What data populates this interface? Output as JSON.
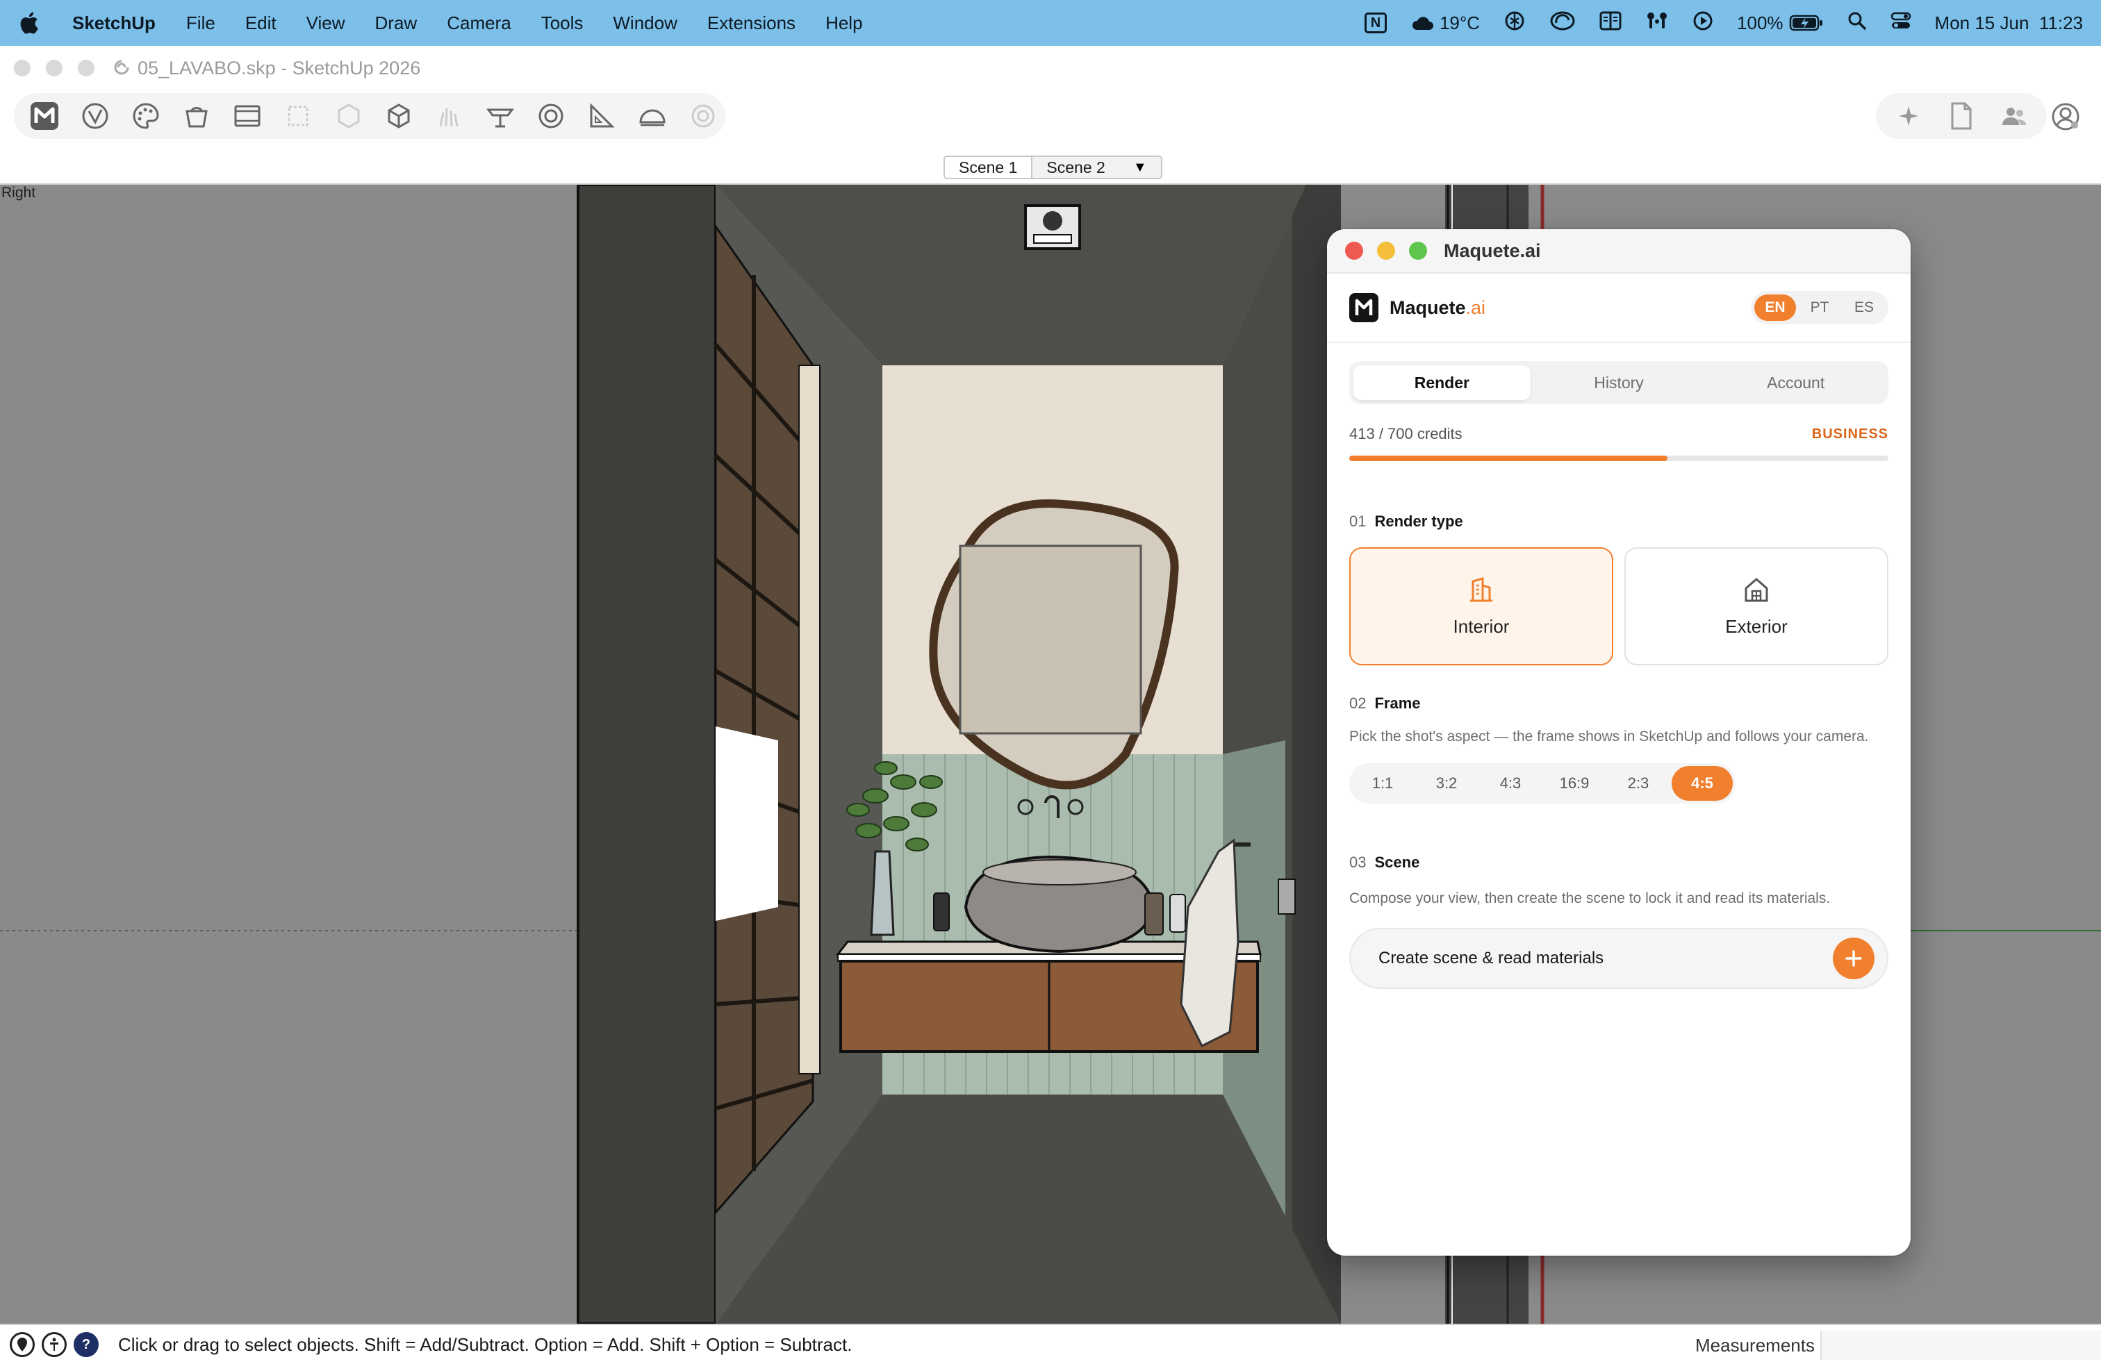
{
  "menubar": {
    "app_name": "SketchUp",
    "menus": [
      "File",
      "Edit",
      "View",
      "Draw",
      "Camera",
      "Tools",
      "Window",
      "Extensions",
      "Help"
    ],
    "status": {
      "notion_icon": "N",
      "weather": "19°C",
      "battery": "100%",
      "datetime": "Mon 15 Jun  11:23"
    }
  },
  "window": {
    "title": "05_LAVABO.skp - SketchUp 2026"
  },
  "toolbar": {
    "tools": [
      "maquete-logo",
      "vray",
      "palette",
      "enscape",
      "window-frame",
      "selection-box",
      "cube",
      "box",
      "grass",
      "table",
      "target",
      "triangle-ruler",
      "dome",
      "circle-tool"
    ],
    "right_tools": [
      "sparkle",
      "document",
      "users"
    ]
  },
  "scenes": {
    "tabs": [
      "Scene 1",
      "Scene 2"
    ],
    "active": "Scene 1",
    "dropdown": "▼"
  },
  "viewport": {
    "view_name": "Right"
  },
  "statusbar": {
    "message": "Click or drag to select objects. Shift = Add/Subtract. Option = Add. Shift + Option = Subtract.",
    "measurements_label": "Measurements",
    "help_icon": "?"
  },
  "plugin": {
    "window_title": "Maquete.ai",
    "brand": {
      "name": "Maquete",
      "suffix": ".ai"
    },
    "languages": [
      "EN",
      "PT",
      "ES"
    ],
    "active_language": "EN",
    "tabs": [
      "Render",
      "History",
      "Account"
    ],
    "active_tab": "Render",
    "credits": {
      "text": "413 / 700 credits",
      "used": 413,
      "total": 700,
      "plan": "BUSINESS"
    },
    "render_type": {
      "number": "01",
      "title": "Render type",
      "options": [
        "Interior",
        "Exterior"
      ],
      "selected": "Interior"
    },
    "frame": {
      "number": "02",
      "title": "Frame",
      "description": "Pick the shot's aspect — the frame shows in SketchUp and follows your camera.",
      "ratios": [
        "1:1",
        "3:2",
        "4:3",
        "16:9",
        "2:3",
        "4:5"
      ],
      "selected": "4:5"
    },
    "scene": {
      "number": "03",
      "title": "Scene",
      "description": "Compose your view, then create the scene to lock it and read its materials.",
      "button_label": "Create scene & read materials",
      "button_icon": "+"
    },
    "colors": {
      "accent": "#f07f2e",
      "accent_light": "#fff4ea",
      "plan": "#d9661a"
    }
  }
}
